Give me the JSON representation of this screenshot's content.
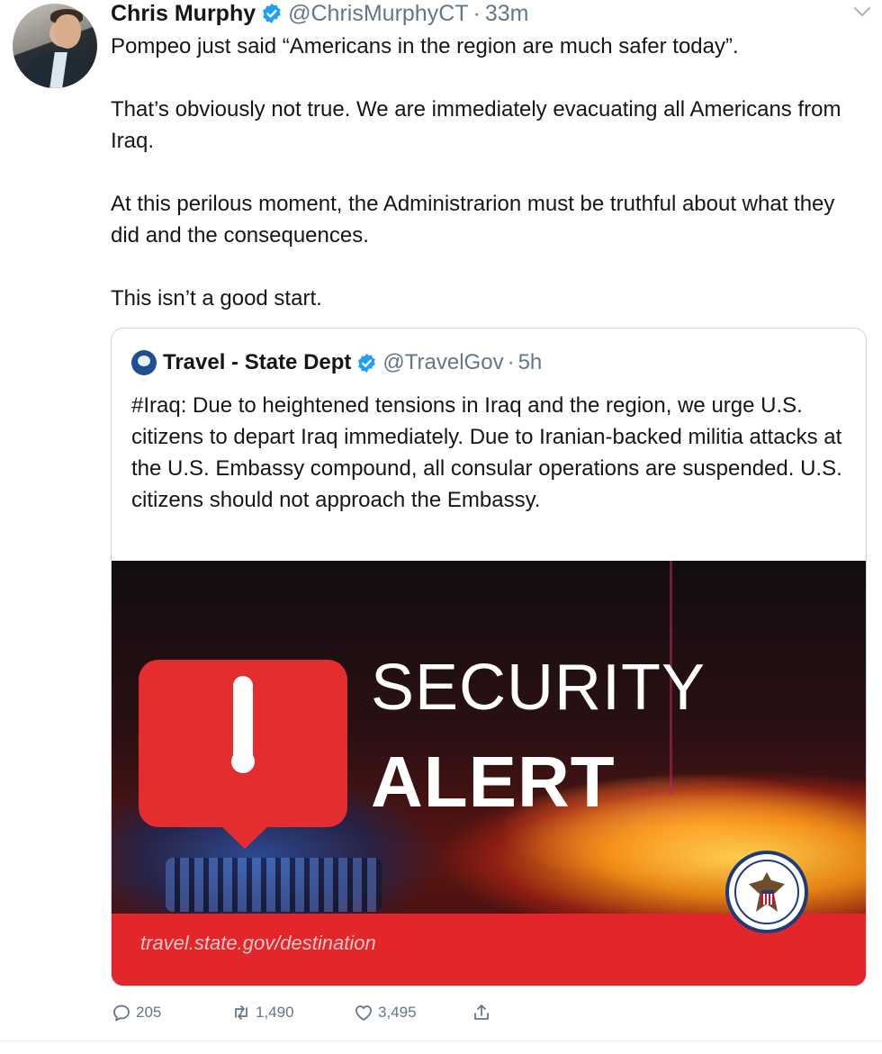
{
  "tweet": {
    "author_name": "Chris Murphy",
    "handle": "@ChrisMurphyCT",
    "separator": "·",
    "time": "33m",
    "paragraphs": [
      "Pompeo just said “Americans in the region are much safer today”.",
      "That’s obviously not true. We are immediately evacuating all Americans from Iraq.",
      "At this perilous moment, the Administrarion must be truthful about what they did and the consequences.",
      "This isn’t a good start."
    ]
  },
  "quoted_tweet": {
    "author_name": "Travel - State Dept",
    "handle": "@TravelGov",
    "separator": "·",
    "time": "5h",
    "text": "#Iraq: Due to heightened tensions in Iraq and the region, we urge U.S. citizens to depart Iraq immediately. Due to Iranian-backed militia attacks at the U.S. Embassy compound, all consular operations are suspended. U.S. citizens should not approach the Embassy.",
    "image": {
      "title_line1": "SECURITY",
      "title_line2": "ALERT",
      "url": "travel.state.gov/destination"
    }
  },
  "actions": {
    "replies": "205",
    "retweets": "1,490",
    "likes": "3,495"
  },
  "colors": {
    "verified_blue": "#1da1f2",
    "secondary_text": "#657786",
    "alert_red": "#e3262b"
  },
  "icons": [
    "verified-badge-icon",
    "chevron-down-icon",
    "reply-icon",
    "retweet-icon",
    "like-icon",
    "share-icon",
    "state-dept-seal-icon",
    "alert-bubble-icon"
  ]
}
